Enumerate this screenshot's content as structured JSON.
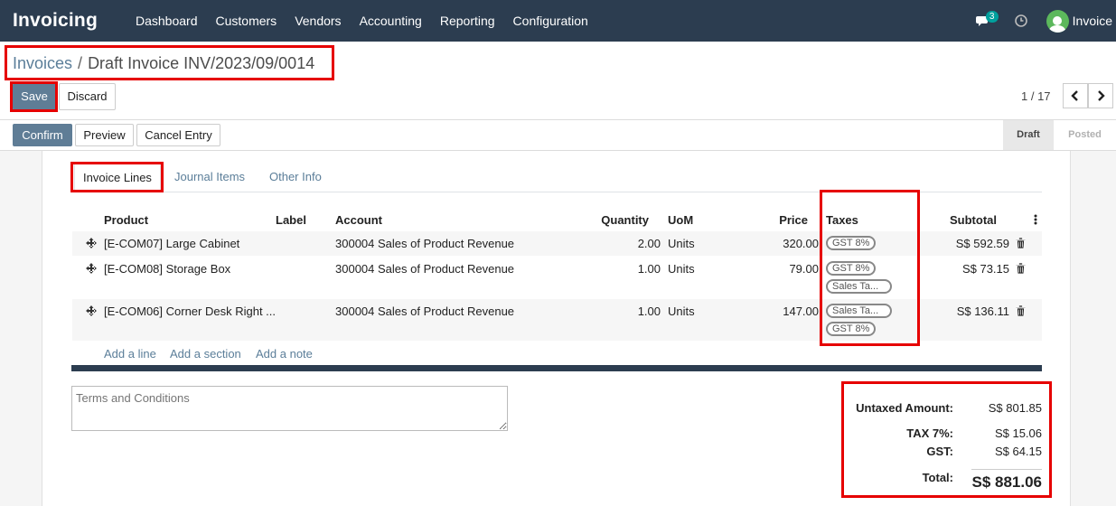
{
  "navbar": {
    "app_name": "Invoicing",
    "menu": [
      "Dashboard",
      "Customers",
      "Vendors",
      "Accounting",
      "Reporting",
      "Configuration"
    ],
    "message_count": "3",
    "user_name": "Invoice"
  },
  "breadcrumb": {
    "parent": "Invoices",
    "separator": "/",
    "current": "Draft Invoice INV/2023/09/0014"
  },
  "actions": {
    "save": "Save",
    "discard": "Discard"
  },
  "pager": {
    "text": "1 / 17"
  },
  "header_buttons": {
    "confirm": "Confirm",
    "preview": "Preview",
    "cancel_entry": "Cancel Entry"
  },
  "status": {
    "active": "Draft",
    "next": "Posted"
  },
  "tabs": {
    "invoice_lines": "Invoice Lines",
    "journal_items": "Journal Items",
    "other_info": "Other Info"
  },
  "columns": {
    "product": "Product",
    "label": "Label",
    "account": "Account",
    "quantity": "Quantity",
    "uom": "UoM",
    "price": "Price",
    "taxes": "Taxes",
    "subtotal": "Subtotal"
  },
  "lines": [
    {
      "product": "[E-COM07] Large Cabinet",
      "account": "300004 Sales of Product Revenue",
      "quantity": "2.00",
      "uom": "Units",
      "price": "320.00",
      "taxes": [
        "GST 8%"
      ],
      "subtotal": "S$ 592.59"
    },
    {
      "product": "[E-COM08] Storage Box",
      "account": "300004 Sales of Product Revenue",
      "quantity": "1.00",
      "uom": "Units",
      "price": "79.00",
      "taxes": [
        "GST 8%",
        "Sales Ta..."
      ],
      "subtotal": "S$ 73.15"
    },
    {
      "product": "[E-COM06] Corner Desk Right ...",
      "account": "300004 Sales of Product Revenue",
      "quantity": "1.00",
      "uom": "Units",
      "price": "147.00",
      "taxes": [
        "Sales Ta...",
        "GST 8%"
      ],
      "subtotal": "S$ 136.11"
    }
  ],
  "add_links": {
    "line": "Add a line",
    "section": "Add a section",
    "note": "Add a note"
  },
  "terms_placeholder": "Terms and Conditions",
  "totals": {
    "untaxed_label": "Untaxed Amount:",
    "untaxed_value": "S$ 801.85",
    "tax7_label": "TAX 7%:",
    "tax7_value": "S$ 15.06",
    "gst_label": "GST:",
    "gst_value": "S$ 64.15",
    "total_label": "Total:",
    "total_value": "S$ 881.06"
  },
  "colors": {
    "navbar": "#2c3d50",
    "primary": "#5f7d96",
    "link": "#5b7e99",
    "highlight": "#e60000"
  }
}
